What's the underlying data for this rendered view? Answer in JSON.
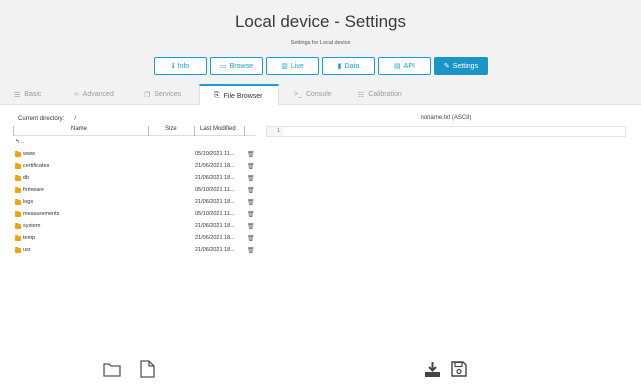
{
  "page": {
    "title": "Local device - Settings",
    "subtitle": "Settings for Local device"
  },
  "nav": [
    {
      "label": "Info",
      "icon": "info-icon",
      "glyph": "ℹ"
    },
    {
      "label": "Browse",
      "icon": "folder-open-icon",
      "glyph": "▭"
    },
    {
      "label": "Live",
      "icon": "chart-icon",
      "glyph": "▥"
    },
    {
      "label": "Data",
      "icon": "file-icon",
      "glyph": "▮"
    },
    {
      "label": "API",
      "icon": "api-icon",
      "glyph": "▤"
    },
    {
      "label": "Settings",
      "icon": "wrench-icon",
      "glyph": "✎",
      "active": true
    }
  ],
  "tabs": [
    {
      "label": "Basic",
      "glyph": "☰"
    },
    {
      "label": "Advanced",
      "glyph": "‹›"
    },
    {
      "label": "Services",
      "glyph": "❐"
    },
    {
      "label": "File Browser",
      "glyph": "⎘",
      "active": true
    },
    {
      "label": "Console",
      "glyph": ">_"
    },
    {
      "label": "Calibration",
      "glyph": "☷"
    }
  ],
  "file_browser": {
    "current_directory_label": "Current directory:",
    "current_directory": "/",
    "columns": {
      "name": "Name",
      "size": "Size",
      "modified": "Last Modified"
    },
    "parent": "..",
    "rows": [
      {
        "name": "www",
        "date": "05/10/2021 11..."
      },
      {
        "name": "certificates",
        "date": "21/06/2021 18..."
      },
      {
        "name": "db",
        "date": "21/06/2021 18..."
      },
      {
        "name": "firmware",
        "date": "05/10/2021 11..."
      },
      {
        "name": "logs",
        "date": "21/06/2021 18..."
      },
      {
        "name": "measurements",
        "date": "05/10/2021 11..."
      },
      {
        "name": "system",
        "date": "21/06/2021 18..."
      },
      {
        "name": "temp",
        "date": "21/06/2021 18..."
      },
      {
        "name": "usr",
        "date": "21/06/2021 18..."
      }
    ]
  },
  "editor": {
    "title": "noname.txt (ASCII)",
    "line_number": "1"
  },
  "colors": {
    "accent": "#1a9fd0",
    "folder": "#f0a30a"
  }
}
